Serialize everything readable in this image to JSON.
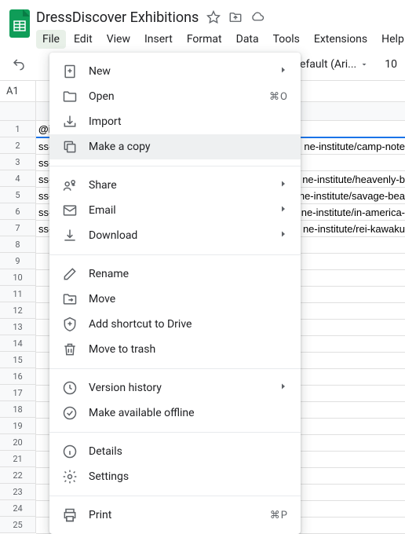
{
  "header": {
    "doc_title": "DressDiscover Exhibitions"
  },
  "menubar": {
    "items": [
      "File",
      "Edit",
      "View",
      "Insert",
      "Format",
      "Data",
      "Tools",
      "Extensions",
      "Help"
    ]
  },
  "toolbar": {
    "font_name": "Default (Ari...",
    "font_size": "10"
  },
  "namebox": "A1",
  "rows": [
    "@id",
    "ss-",
    "ss-",
    "ss-",
    "ss-",
    "ss-",
    "ss-"
  ],
  "rows_b": [
    "",
    "ne-institute/camp-note",
    "",
    "ne-institute/heavenly-b",
    "ne-institute/savage-bea",
    "ne-institute/in-america-",
    "ne-institute/rei-kawaku"
  ],
  "dropdown": {
    "new": "New",
    "open": "Open",
    "open_kbd": "⌘O",
    "import": "Import",
    "make_copy": "Make a copy",
    "share": "Share",
    "email": "Email",
    "download": "Download",
    "rename": "Rename",
    "move": "Move",
    "shortcut": "Add shortcut to Drive",
    "trash": "Move to trash",
    "version": "Version history",
    "offline": "Make available offline",
    "details": "Details",
    "settings": "Settings",
    "print": "Print",
    "print_kbd": "⌘P"
  }
}
